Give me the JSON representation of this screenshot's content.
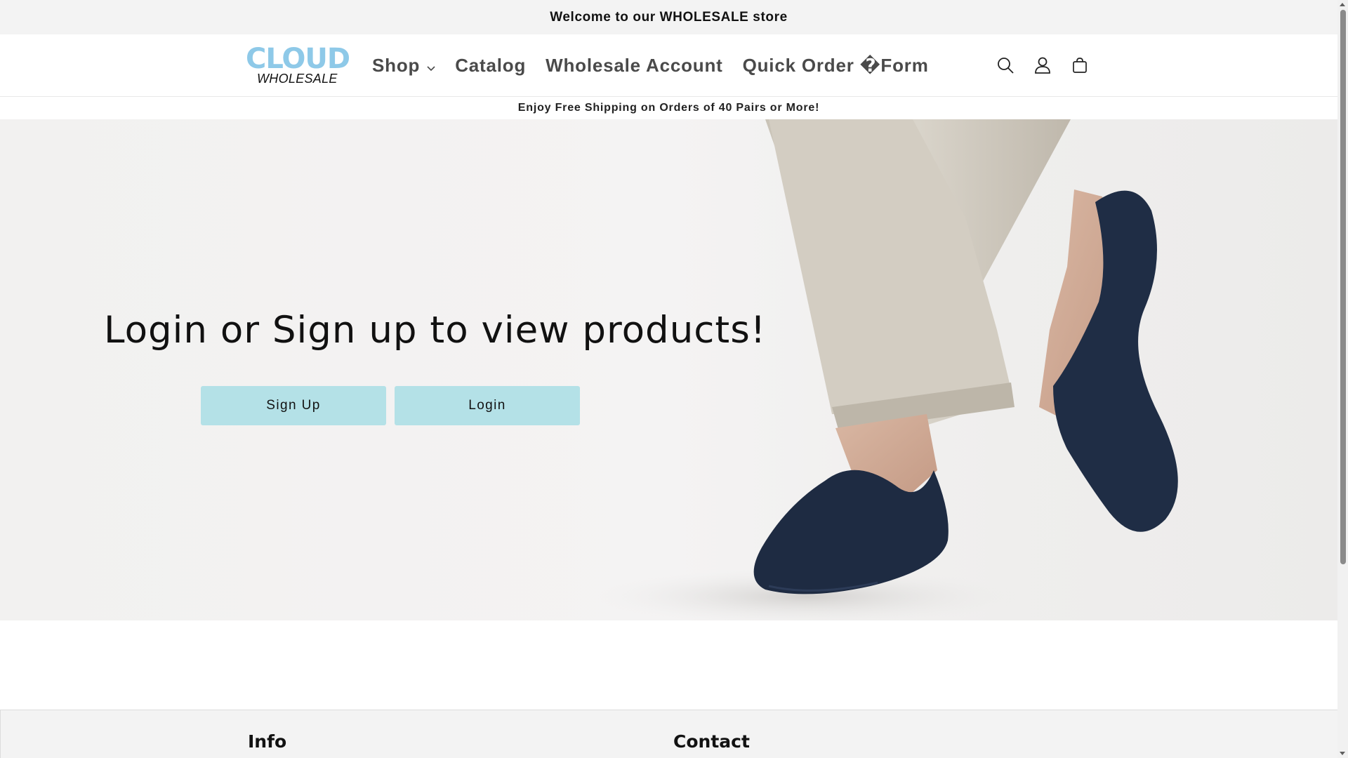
{
  "announcement": {
    "text": "Welcome to our WHOLESALE store"
  },
  "logo": {
    "top": "CLOUD",
    "bottom": "WHOLESALE"
  },
  "nav": {
    "shop": "Shop",
    "catalog": "Catalog",
    "wholesale_account": "Wholesale Account",
    "quick_order": "Quick Order �Form"
  },
  "header_icons": [
    "search-icon",
    "account-icon",
    "cart-icon"
  ],
  "shipping_bar": {
    "text": "Enjoy Free Shipping on Orders of 40 Pairs or More!"
  },
  "hero": {
    "title": "Login or Sign up to view products!",
    "signup_label": "Sign Up",
    "login_label": "Login"
  },
  "footer": {
    "info_heading": "Info",
    "contact_heading": "Contact"
  },
  "colors": {
    "accent_button": "#b4e1e7",
    "logo_blue": "#8ec9e8",
    "sock_navy": "#1f2d45",
    "announcement_bg": "#f3f3f3"
  }
}
